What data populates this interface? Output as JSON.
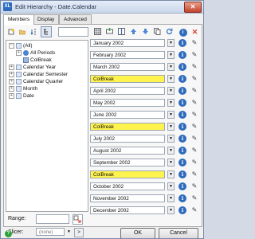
{
  "window": {
    "title": "Edit Hierarchy - Date.Calendar",
    "app_icon": "XL",
    "close": "✕"
  },
  "tabs": [
    {
      "label": "Members"
    },
    {
      "label": "Display"
    },
    {
      "label": "Advanced"
    }
  ],
  "tree": {
    "nodes": [
      {
        "label": "(All)"
      },
      {
        "label": "All Periods"
      },
      {
        "label": "ColBreak"
      },
      {
        "label": "Calendar Year"
      },
      {
        "label": "Calendar Semester"
      },
      {
        "label": "Calendar Quarter"
      },
      {
        "label": "Month"
      },
      {
        "label": "Date"
      }
    ]
  },
  "range": {
    "label": "Range:"
  },
  "slicer": {
    "label": "Slicer:",
    "value": "(none)",
    "go": ">"
  },
  "members": [
    {
      "label": "January 2002"
    },
    {
      "label": "February 2002"
    },
    {
      "label": "March 2002"
    },
    {
      "label": "ColBreak"
    },
    {
      "label": "April 2002"
    },
    {
      "label": "May 2002"
    },
    {
      "label": "June 2002"
    },
    {
      "label": "ColBreak"
    },
    {
      "label": "July 2002"
    },
    {
      "label": "August 2002"
    },
    {
      "label": "September 2002"
    },
    {
      "label": "ColBreak"
    },
    {
      "label": "October 2002"
    },
    {
      "label": "November 2002"
    },
    {
      "label": "December 2002"
    }
  ],
  "buttons": {
    "ok": "OK",
    "cancel": "Cancel",
    "help": "?"
  },
  "colors": {
    "colbreak_highlight": "#fff34d",
    "info_blue": "#2f6bbd",
    "delete_red": "#d93a2b"
  }
}
